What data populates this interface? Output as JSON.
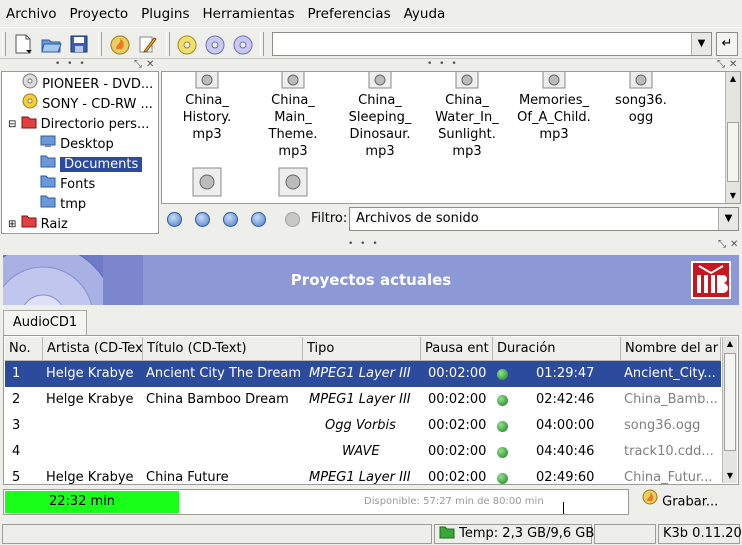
{
  "menu": [
    {
      "label": "Archivo"
    },
    {
      "label": "Proyecto"
    },
    {
      "label": "Plugins"
    },
    {
      "label": "Herramientas"
    },
    {
      "label": "Preferencias"
    },
    {
      "label": "Ayuda"
    }
  ],
  "toolbar": {
    "location_value": "",
    "icons": [
      "new-file-icon",
      "open-folder-icon",
      "save-icon",
      "burn-icon",
      "edit-icon",
      "disc-info-icon",
      "cd-icon",
      "cd-icon-2",
      "cd-icon-3"
    ]
  },
  "tree": {
    "items": [
      {
        "label": "PIONEER - DVD..."
      },
      {
        "label": "SONY - CD-RW  ..."
      },
      {
        "label": "Directorio pers..."
      },
      {
        "label": "Desktop"
      },
      {
        "label": "Documents"
      },
      {
        "label": "Fonts"
      },
      {
        "label": "tmp"
      },
      {
        "label": "Raiz"
      }
    ]
  },
  "files": [
    {
      "lines": [
        "China_",
        "History.",
        "mp3"
      ]
    },
    {
      "lines": [
        "China_",
        "Main_",
        "Theme.",
        "mp3"
      ]
    },
    {
      "lines": [
        "China_",
        "Sleeping_",
        "Dinosaur.",
        "mp3"
      ]
    },
    {
      "lines": [
        "China_",
        "Water_In_",
        "Sunlight.",
        "mp3"
      ]
    },
    {
      "lines": [
        "Memories_",
        "Of_A_Child.",
        "mp3"
      ]
    },
    {
      "lines": [
        "song36.",
        "ogg"
      ]
    }
  ],
  "filter": {
    "label": "Filtro:",
    "value": "Archivos de sonido"
  },
  "projects": {
    "title": "Proyectos actuales",
    "tab": "AudioCD1"
  },
  "table": {
    "columns": [
      "No.",
      "Artista (CD-Tex",
      "Título (CD-Text)",
      "Tipo",
      "Pausa ent",
      "Duración",
      "Nombre del ar"
    ],
    "rows": [
      {
        "no": "1",
        "artist": "Helge Krabye",
        "title": "Ancient City The Dream",
        "type": "MPEG1 Layer III",
        "pause": "00:02:00",
        "duration": "01:29:47",
        "filename": "Ancient_City..."
      },
      {
        "no": "2",
        "artist": "Helge Krabye",
        "title": "China Bamboo Dream",
        "type": "MPEG1 Layer III",
        "pause": "00:02:00",
        "duration": "02:42:46",
        "filename": "China_Bamb..."
      },
      {
        "no": "3",
        "artist": "",
        "title": "",
        "type": "Ogg Vorbis",
        "pause": "00:02:00",
        "duration": "04:00:00",
        "filename": "song36.ogg"
      },
      {
        "no": "4",
        "artist": "",
        "title": "",
        "type": "WAVE",
        "pause": "00:02:00",
        "duration": "04:40:46",
        "filename": "track10.cdd..."
      },
      {
        "no": "5",
        "artist": "Helge Krabye",
        "title": "China Future",
        "type": "MPEG1 Layer III",
        "pause": "00:02:00",
        "duration": "02:49:60",
        "filename": "China_Futur..."
      }
    ]
  },
  "size": {
    "used": "22:32 min",
    "available": "Disponible: 57:27 min de 80:00 min",
    "fill_fraction": 0.28
  },
  "burn_button": "Grabar...",
  "status": {
    "temp": "Temp: 2,3 GB/9,6 GB",
    "version": "K3b 0.11.20"
  },
  "colors": {
    "selection": "#2d4b9d",
    "header": "#8d98d6",
    "progress": "#19ff19"
  }
}
